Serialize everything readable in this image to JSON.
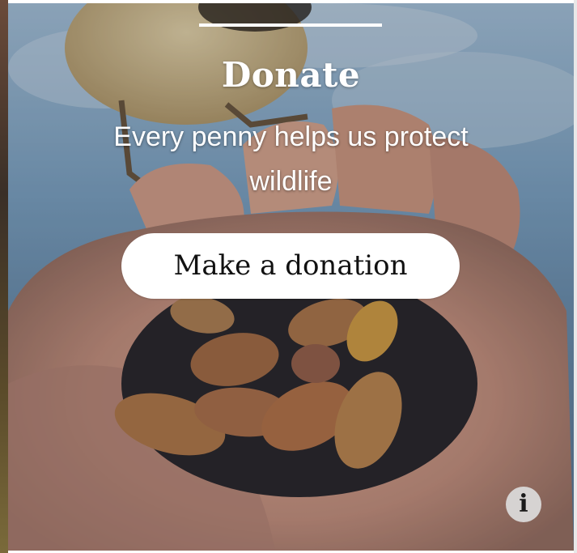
{
  "card": {
    "title": "Donate",
    "subtitle": "Every penny helps us protect wildlife",
    "cta_label": "Make a donation",
    "info_label": "i"
  },
  "icons": {
    "info": "info-icon"
  },
  "colors": {
    "button_bg": "#ffffff",
    "button_text": "#111111",
    "heading_text": "#ffffff",
    "info_bg": "#dcdcdc"
  }
}
